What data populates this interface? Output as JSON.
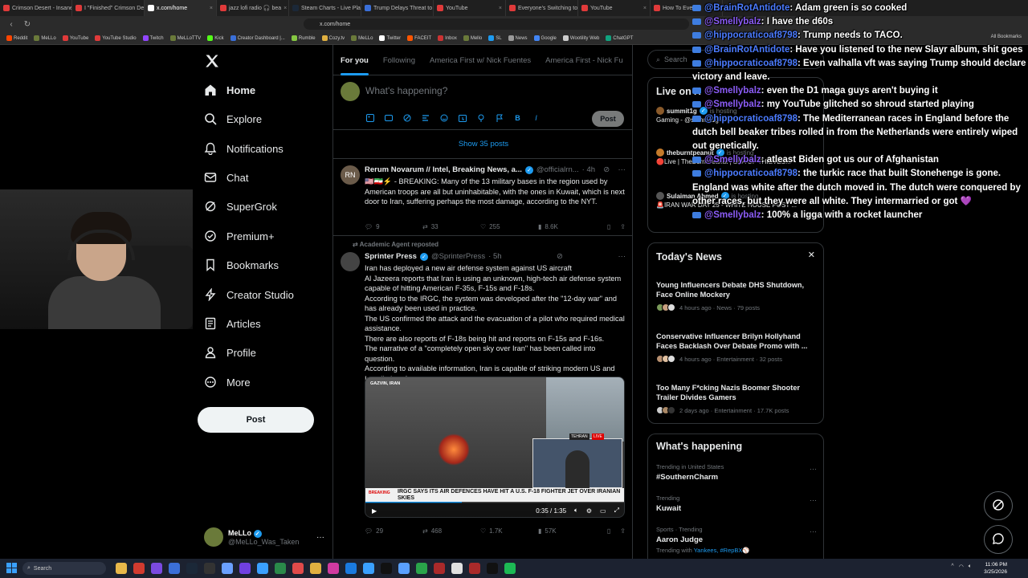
{
  "browser": {
    "tabs": [
      {
        "label": "Crimson Desert - Insane",
        "color": "#e03a3a",
        "active": false
      },
      {
        "label": "I \"Finished\" Crimson Des",
        "color": "#e03a3a",
        "active": false
      },
      {
        "label": "x.com/home",
        "color": "#ffffff",
        "active": true
      },
      {
        "label": "jazz lofi radio 🎧 bea",
        "color": "#e03a3a",
        "active": false
      },
      {
        "label": "Steam Charts - Live Playe",
        "color": "#1b2838",
        "active": false
      },
      {
        "label": "Trump Delays Threat to",
        "color": "#3a6fd8",
        "active": false
      },
      {
        "label": "YouTube",
        "color": "#e03a3a",
        "active": false
      },
      {
        "label": "Everyone's Switching to",
        "color": "#e03a3a",
        "active": false
      },
      {
        "label": "YouTube",
        "color": "#e03a3a",
        "active": false
      },
      {
        "label": "How To Eve",
        "color": "#e03a3a",
        "active": false
      }
    ],
    "url": "x.com/home",
    "bookmarks": [
      "Reddit",
      "MeLLo",
      "YouTube",
      "YouTube Studio",
      "Twitch",
      "MeLLoTTV",
      "Kick",
      "Creator Dashboard |...",
      "Rumble",
      "Cozy.tv",
      "MeLLo",
      "Twitter",
      "FACEIT",
      "Inbox",
      "Mello",
      "SL",
      "News",
      "Google",
      "Wootility Web",
      "ChatGPT"
    ],
    "all_bookmarks": "All Bookmarks"
  },
  "nav": {
    "logo": "X",
    "items": [
      {
        "label": "Home",
        "icon": "home-icon",
        "bold": true
      },
      {
        "label": "Explore",
        "icon": "search-icon",
        "bold": false
      },
      {
        "label": "Notifications",
        "icon": "bell-icon",
        "bold": false
      },
      {
        "label": "Chat",
        "icon": "mail-icon",
        "bold": false
      },
      {
        "label": "SuperGrok",
        "icon": "grok-icon",
        "bold": false
      },
      {
        "label": "Premium+",
        "icon": "premium-icon",
        "bold": false
      },
      {
        "label": "Bookmarks",
        "icon": "bookmark-icon",
        "bold": false
      },
      {
        "label": "Creator Studio",
        "icon": "bolt-icon",
        "bold": false
      },
      {
        "label": "Articles",
        "icon": "article-icon",
        "bold": false
      },
      {
        "label": "Profile",
        "icon": "user-icon",
        "bold": false
      },
      {
        "label": "More",
        "icon": "more-icon",
        "bold": false
      }
    ],
    "post_label": "Post",
    "account": {
      "name": "MeLLo",
      "handle": "@MeLLo_Was_Taken"
    }
  },
  "feed": {
    "tabs": [
      "For you",
      "Following",
      "America First w/ Nick Fuentes",
      "America First - Nick Fu"
    ],
    "composer": {
      "placeholder": "What's happening?",
      "post_label": "Post"
    },
    "show_posts": "Show 35 posts",
    "posts": [
      {
        "avatar_text": "RN",
        "name": "Rerum Novarum // Intel, Breaking News, a...",
        "handle": "@officialrn...",
        "time": "· 4h",
        "reposted": "",
        "lines": [
          "🇺🇸🇮🇷⚡ - BREAKING: Many of the 13 military bases in the region used by American troops are all but uninhabitable, with the ones in Kuwait, which is next door to Iran, suffering perhaps the most damage, according to the NYT."
        ],
        "replies": "9",
        "reposts": "33",
        "likes": "255",
        "views": "8.6K"
      },
      {
        "avatar_text": "",
        "name": "Sprinter Press",
        "handle": "@SprinterPress",
        "time": "· 5h",
        "reposted": "Academic Agent reposted",
        "lines": [
          "Iran has deployed a new air defense system against US aircraft",
          " Al Jazeera reports that Iran is using an unknown, high-tech air defense system capable of hitting American F-35s, F-15s and F-18s.",
          " According to the IRGC, the system was developed after the \"12-day war\" and has already been used in practice.",
          " The US confirmed the attack and the evacuation of a pilot who required medical assistance.",
          " There are also reports of F-18s being hit and reports on F-15s and F-16s.",
          " The narrative of a \"completely open sky over Iran\" has been called into question.",
          "According to available information, Iran is capable of striking modern US and Israeli aircraft."
        ],
        "media": {
          "location": "GAZVIN, IRAN",
          "inset_city": "TEHRAN",
          "live": "LIVE",
          "banner": "IRGC SAYS ITS AIR DEFENCES HAVE HIT A U.S. F-18 FIGHTER JET OVER IRANIAN SKIES",
          "breaking": "BREAKING",
          "time": "0:35 / 1:35",
          "progress": 0.37
        },
        "replies": "29",
        "reposts": "468",
        "likes": "1.7K",
        "views": "57K"
      }
    ]
  },
  "sidebar": {
    "search_placeholder": "Search",
    "live_title": "Live on X",
    "live": [
      {
        "name": "summit1g",
        "host": "is hosting",
        "title": "Gaming - @summit1g",
        "color": "#8a5a2a"
      },
      {
        "name": "theburntpeanut",
        "host": "is hosting",
        "title": "🔴Live | TheBurntPeanut | SEA OF THIEVES...",
        "color": "#c47a2a"
      },
      {
        "name": "Sulaiman Ahmed",
        "host": "is hosting",
        "title": "🚨IRAN WAR DAY 25 - WHITE HOUSE POST ...",
        "color": "#555555"
      }
    ],
    "news_title": "Today's News",
    "news": [
      {
        "title": "Young Influencers Debate DHS Shutdown, Face Online Mockery",
        "meta": "4 hours ago · News · 79 posts"
      },
      {
        "title": "Conservative Influencer Brilyn Hollyhand Faces Backlash Over Debate Promo with ...",
        "meta": "4 hours ago · Entertainment · 32 posts"
      },
      {
        "title": "Too Many F*cking Nazis Boomer Shooter Trailer Divides Gamers",
        "meta": "2 days ago · Entertainment · 17.7K posts"
      }
    ],
    "happening_title": "What's happening",
    "trends": [
      {
        "meta": "Trending in United States",
        "name": "#SouthernCharm",
        "sub": "",
        "sub_link": ""
      },
      {
        "meta": "Trending",
        "name": "Kuwait",
        "sub": "",
        "sub_link": ""
      },
      {
        "meta": "Sports · Trending",
        "name": "Aaron Judge",
        "sub": "Trending with ",
        "sub_link": "Yankees, #RepBX⚾"
      }
    ]
  },
  "chat": [
    {
      "user": "@BrainRotAntidote",
      "msg": ": Adam green is so cooked",
      "cls": "u1"
    },
    {
      "user": "@Smellybalz",
      "msg": ": I have the d60s",
      "cls": "u2"
    },
    {
      "user": "@hippocraticoaf8798",
      "msg": ": Trump needs to TACO.",
      "cls": "u1"
    },
    {
      "user": "@BrainRotAntidote",
      "msg": ": Have you listened to the new Slayr album, shit goes",
      "cls": "u1"
    },
    {
      "user": "@hippocraticoaf8798",
      "msg": ": Even valhalla vft was saying Trump should declare victory and leave.",
      "cls": "u1"
    },
    {
      "user": "@Smellybalz",
      "msg": ": even the D1 maga guys aren't buying it",
      "cls": "u2"
    },
    {
      "user": "@Smellybalz",
      "msg": ": my YouTube glitched so shroud started playing",
      "cls": "u2"
    },
    {
      "user": "@hippocraticoaf8798",
      "msg": ": The Mediterranean races in England before the dutch bell beaker tribes rolled in from the Netherlands were entirely wiped out genetically.",
      "cls": "u1"
    },
    {
      "user": "@Smellybalz",
      "msg": ": atleast Biden got us our of Afghanistan",
      "cls": "u2"
    },
    {
      "user": "@hippocraticoaf8798",
      "msg": ": the turkic race that built Stonehenge is gone. England was white after the dutch moved in. The dutch were conquered by other races, but they were all white. They intermarried or got 💜",
      "cls": "u1"
    },
    {
      "user": "@Smellybalz",
      "msg": ": 100% a ligga with a rocket launcher",
      "cls": "u2"
    }
  ],
  "taskbar": {
    "search": "Search",
    "time": "11:06 PM",
    "date": "3/25/2026"
  }
}
